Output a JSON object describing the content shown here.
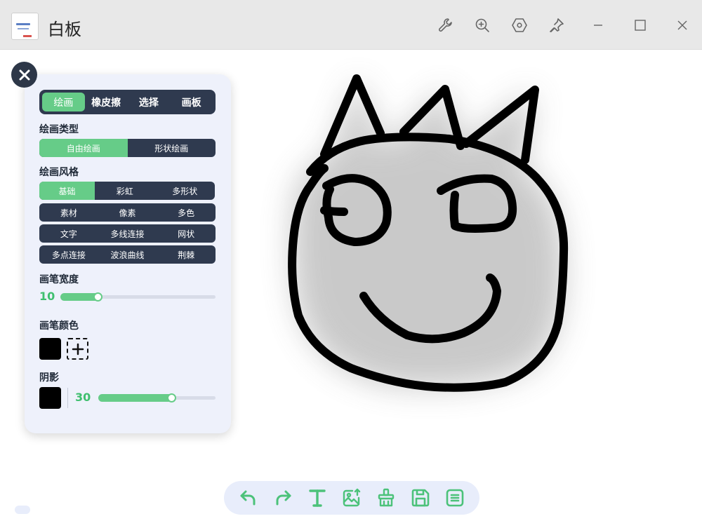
{
  "window": {
    "title": "白板"
  },
  "panel": {
    "tabs": [
      {
        "label": "绘画",
        "active": true
      },
      {
        "label": "橡皮擦",
        "active": false
      },
      {
        "label": "选择",
        "active": false
      },
      {
        "label": "画板",
        "active": false
      }
    ],
    "draw_type_label": "绘画类型",
    "draw_types": [
      {
        "label": "自由绘画",
        "active": true
      },
      {
        "label": "形状绘画",
        "active": false
      }
    ],
    "draw_style_label": "绘画风格",
    "draw_styles": [
      [
        {
          "label": "基础",
          "active": true
        },
        {
          "label": "彩虹",
          "active": false
        },
        {
          "label": "多形状",
          "active": false
        }
      ],
      [
        {
          "label": "素材",
          "active": false
        },
        {
          "label": "像素",
          "active": false
        },
        {
          "label": "多色",
          "active": false
        }
      ],
      [
        {
          "label": "文字",
          "active": false
        },
        {
          "label": "多线连接",
          "active": false
        },
        {
          "label": "网状",
          "active": false
        }
      ],
      [
        {
          "label": "多点连接",
          "active": false
        },
        {
          "label": "波浪曲线",
          "active": false
        },
        {
          "label": "荆棘",
          "active": false
        }
      ]
    ],
    "brush_width_label": "画笔宽度",
    "brush_width": {
      "value": "10",
      "fraction": 0.22
    },
    "brush_color_label": "画笔颜色",
    "brush_color": "#000000",
    "shadow_label": "阴影",
    "shadow_color": "#000000",
    "shadow": {
      "value": "30",
      "fraction": 0.6
    }
  },
  "toolbar": {
    "items": [
      "undo-icon",
      "redo-icon",
      "text-icon",
      "image-upload-icon",
      "clean-brush-icon",
      "save-icon",
      "list-icon"
    ]
  },
  "colors": {
    "accent": "#66cc88",
    "dark": "#2f3a4f",
    "panel_bg": "#eef1fb"
  }
}
